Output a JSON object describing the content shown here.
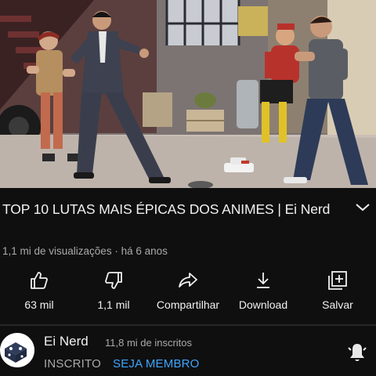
{
  "video": {
    "title": "TOP 10 LUTAS MAIS ÉPICAS DOS ANIMES | Ei Nerd",
    "views": "1,1 mi de visualizações",
    "separator": " · ",
    "age": "há 6 anos"
  },
  "actions": [
    {
      "label": "63 mil",
      "icon": "thumbs-up-icon"
    },
    {
      "label": "1,1 mil",
      "icon": "thumbs-down-icon"
    },
    {
      "label": "Compartilhar",
      "icon": "share-icon"
    },
    {
      "label": "Download",
      "icon": "download-icon"
    },
    {
      "label": "Salvar",
      "icon": "add-to-playlist-icon"
    }
  ],
  "channel": {
    "name": "Ei Nerd",
    "subscribers": "11,8 mi de inscritos",
    "subscribed_label": "INSCRITO",
    "join_label": "SEJA MEMBRO"
  },
  "colors": {
    "background": "#0f0f0f",
    "text": "#f1f1f1",
    "secondary_text": "#aaaaaa",
    "link": "#3ea6ff"
  }
}
